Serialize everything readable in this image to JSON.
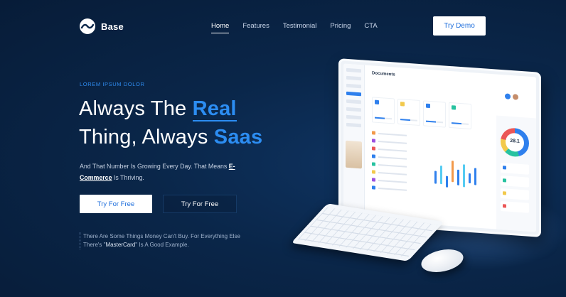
{
  "brand": {
    "name": "Base"
  },
  "nav": {
    "items": [
      {
        "label": "Home",
        "active": true
      },
      {
        "label": "Features",
        "active": false
      },
      {
        "label": "Testimonial",
        "active": false
      },
      {
        "label": "Pricing",
        "active": false
      },
      {
        "label": "CTA",
        "active": false
      }
    ],
    "demo_button": "Try Demo"
  },
  "hero": {
    "eyebrow": "LOREM IPSUM DOLOR",
    "headline_part1": "Always The ",
    "headline_highlight1": "Real",
    "headline_part2": "Thing, Always ",
    "headline_highlight2": "Saas",
    "lead_part1": "And That Number Is Growing Every Day. That Means ",
    "lead_link": "E-Commerce",
    "lead_part2": " Is Thriving.",
    "primary_button": "Try For Free",
    "secondary_button": "Try For Free",
    "quote_part1": "There Are Some Things Money Can't Buy. For Everything Else There's \"",
    "quote_highlight": "MasterCard",
    "quote_part2": "\" Is A Good Example."
  },
  "dashboard": {
    "title": "Documents",
    "storage_value": "28.1"
  },
  "colors": {
    "accent": "#2c8df2",
    "background": "#0a2649",
    "button_text": "#1f6fdc"
  }
}
